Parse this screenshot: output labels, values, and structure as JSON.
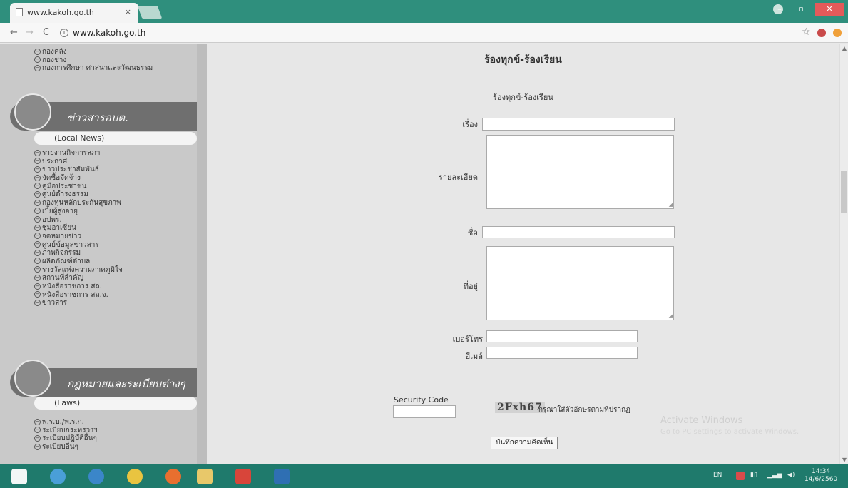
{
  "browser": {
    "tab_title": "www.kakoh.go.th",
    "tab_close": "×",
    "url": "www.kakoh.go.th",
    "nav_back": "←",
    "nav_forward": "→",
    "nav_reload": "C",
    "bookmark_icon": "star-icon"
  },
  "sidebar": {
    "top_items": [
      "กองคลัง",
      "กองช่าง",
      "กองการศึกษา ศาสนาและวัฒนธรรม"
    ],
    "news_banner": "ข่าวสารอบต.",
    "news_sub": "(Local News)",
    "news_items": [
      "รายงานกิจการสภา",
      "ประกาศ",
      "ข่าวประชาสัมพันธ์",
      "จัดซื้อจัดจ้าง",
      "คู่มือประชาชน",
      "ศูนย์ดำรงธรรม",
      "กองทุนหลักประกันสุขภาพ",
      "เบี้ยผู้สูงอายุ",
      "อปพร.",
      "ชุมอาเซียน",
      "จดหมายข่าว",
      "ศูนย์ข้อมูลข่าวสาร",
      "ภาพกิจกรรม",
      "ผลิตภัณฑ์ตำบล",
      "รางวัลแห่งความภาคภูมิใจ",
      "สถานที่สำคัญ",
      "หนังสือราชการ สถ.",
      "หนังสือราชการ สถ.จ.",
      "ข่าวสาร"
    ],
    "laws_banner": "กฎหมายและระเบียบต่างๆ",
    "laws_sub": "(Laws)",
    "laws_items": [
      "พ.ร.บ./พ.ร.ก.",
      "ระเบียบกระทรวงฯ",
      "ระเบียบปฏิบัติอื่นๆ",
      "ระเบียบอื่นๆ"
    ]
  },
  "main": {
    "page_title": "ร้องทุกข์-ร้องเรียน",
    "form_title": "ร้องทุกข์-ร้องเรียน",
    "labels": {
      "subject": "เรื่อง",
      "details": "รายละเอียด",
      "name": "ชื่อ",
      "address": "ที่อยู่",
      "phone": "เบอร์โทร",
      "email": "อีเมล์",
      "security": "Security Code"
    },
    "captcha_text": "2Fxh67",
    "captcha_hint": "กรุณาใส่ตัวอักษรตามที่ปรากฏ",
    "submit_label": "บันทึกความคิดเห็น",
    "watermark": "Activate Windows",
    "watermark_sub": "Go to PC settings to activate Windows."
  },
  "taskbar": {
    "language": "EN",
    "time": "14:34",
    "date": "14/6/2560"
  },
  "colors": {
    "chrome_frame": "#2f8f7d",
    "taskbar": "#1f7a6c",
    "sidebar": "#c9c9c9",
    "banner": "#6f6f6f"
  }
}
